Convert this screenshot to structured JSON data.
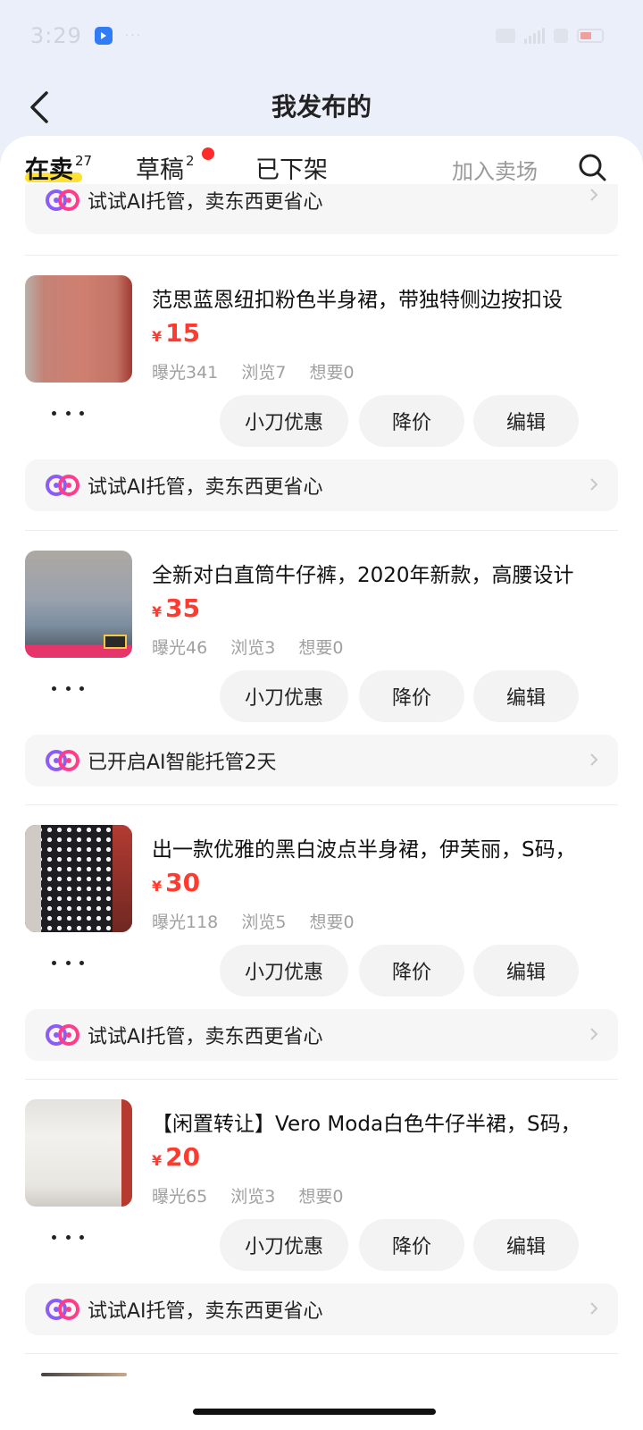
{
  "status_bar": {
    "time": "3:29",
    "dots": "···"
  },
  "header": {
    "title": "我发布的"
  },
  "tabs": [
    {
      "label": "在卖",
      "count": "27",
      "active": true
    },
    {
      "label": "草稿",
      "count": "2",
      "active": false,
      "has_red_dot": true
    },
    {
      "label": "已下架",
      "count": "",
      "active": false
    }
  ],
  "join_market_label": "加入卖场",
  "top_banner": {
    "text": "试试AI托管，卖东西更省心"
  },
  "items": [
    {
      "title": "范思蓝恩纽扣粉色半身裙，带独特侧边按扣设",
      "currency": "¥",
      "price": "15",
      "stats": {
        "exposure": "曝光341",
        "views": "浏览7",
        "wants": "想要0"
      },
      "buttons": {
        "coupon": "小刀优惠",
        "reduce": "降价",
        "edit": "编辑"
      },
      "banner": "试试AI托管，卖东西更省心"
    },
    {
      "title": "全新对白直筒牛仔裤，2020年新款，高腰设计",
      "currency": "¥",
      "price": "35",
      "stats": {
        "exposure": "曝光46",
        "views": "浏览3",
        "wants": "想要0"
      },
      "buttons": {
        "coupon": "小刀优惠",
        "reduce": "降价",
        "edit": "编辑"
      },
      "banner": "已开启AI智能托管2天"
    },
    {
      "title": "出一款优雅的黑白波点半身裙，伊芙丽，S码，",
      "currency": "¥",
      "price": "30",
      "stats": {
        "exposure": "曝光118",
        "views": "浏览5",
        "wants": "想要0"
      },
      "buttons": {
        "coupon": "小刀优惠",
        "reduce": "降价",
        "edit": "编辑"
      },
      "banner": "试试AI托管，卖东西更省心"
    },
    {
      "title": "【闲置转让】Vero Moda白色牛仔半裙，S码，",
      "currency": "¥",
      "price": "20",
      "stats": {
        "exposure": "曝光65",
        "views": "浏览3",
        "wants": "想要0"
      },
      "buttons": {
        "coupon": "小刀优惠",
        "reduce": "降价",
        "edit": "编辑"
      },
      "banner": "试试AI托管，卖东西更省心"
    }
  ],
  "colors": {
    "price": "#ff3b30",
    "tab_underline": "#ffe033",
    "red_dot": "#ff2a2a",
    "page_bg": "#ebeffa"
  },
  "icons": {
    "back": "chevron-left-icon",
    "search": "search-icon",
    "more": "more-dots-icon",
    "ai": "ai-logo-icon",
    "banner_arrow": "chevron-right-icon"
  }
}
